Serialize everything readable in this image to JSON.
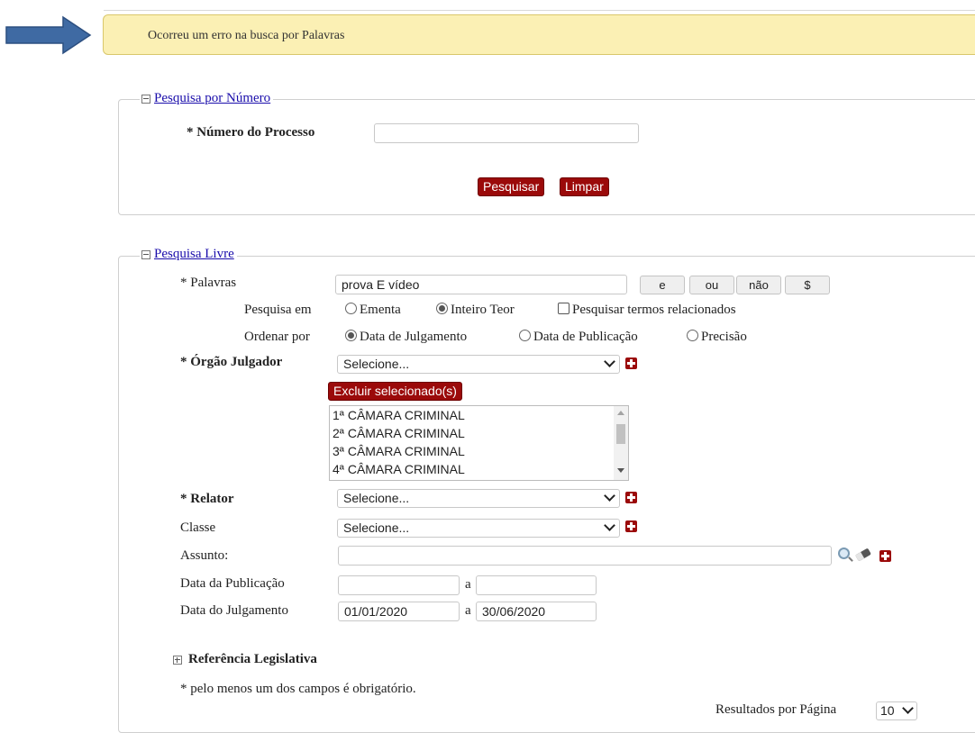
{
  "error": {
    "message": "Ocorreu um erro na busca por Palavras"
  },
  "numero": {
    "legend": "Pesquisa por Número",
    "label": "* Número do Processo",
    "value": "",
    "pesquisar": "Pesquisar",
    "limpar": "Limpar"
  },
  "livre": {
    "legend": "Pesquisa Livre",
    "palavras": {
      "label": "* Palavras",
      "value": "prova E vídeo"
    },
    "operators": [
      "e",
      "ou",
      "não",
      "$"
    ],
    "pesquisa_em": {
      "label": "Pesquisa em",
      "options": [
        "Ementa",
        "Inteiro Teor"
      ],
      "selected": "Inteiro Teor",
      "related": "Pesquisar termos relacionados"
    },
    "ordenar_por": {
      "label": "Ordenar por",
      "options": [
        "Data de Julgamento",
        "Data de Publicação",
        "Precisão"
      ],
      "selected": "Data de Julgamento"
    },
    "orgao": {
      "label": "* Órgão Julgador",
      "select": "Selecione...",
      "excluir": "Excluir selecionado(s)",
      "list": [
        "1ª CÂMARA CRIMINAL",
        "2ª CÂMARA CRIMINAL",
        "3ª CÂMARA CRIMINAL",
        "4ª CÂMARA CRIMINAL"
      ]
    },
    "relator": {
      "label": "* Relator",
      "select": "Selecione..."
    },
    "classe": {
      "label": "Classe",
      "select": "Selecione..."
    },
    "assunto": {
      "label": "Assunto:",
      "value": ""
    },
    "data_publicacao": {
      "label": "Data da Publicação",
      "from": "",
      "sep": "a",
      "to": ""
    },
    "data_julgamento": {
      "label": "Data do Julgamento",
      "from": "01/01/2020",
      "sep": "a",
      "to": "30/06/2020"
    },
    "referencia": "Referência Legislativa",
    "obrigatorio": "* pelo menos um dos campos é obrigatório.",
    "resultados": {
      "label": "Resultados por Página",
      "value": "10"
    }
  },
  "colors": {
    "accent_red": "#9b0a0a",
    "banner_bg": "#fbf0b4",
    "arrow": "#3f6aa3",
    "link": "#1a0dab"
  }
}
